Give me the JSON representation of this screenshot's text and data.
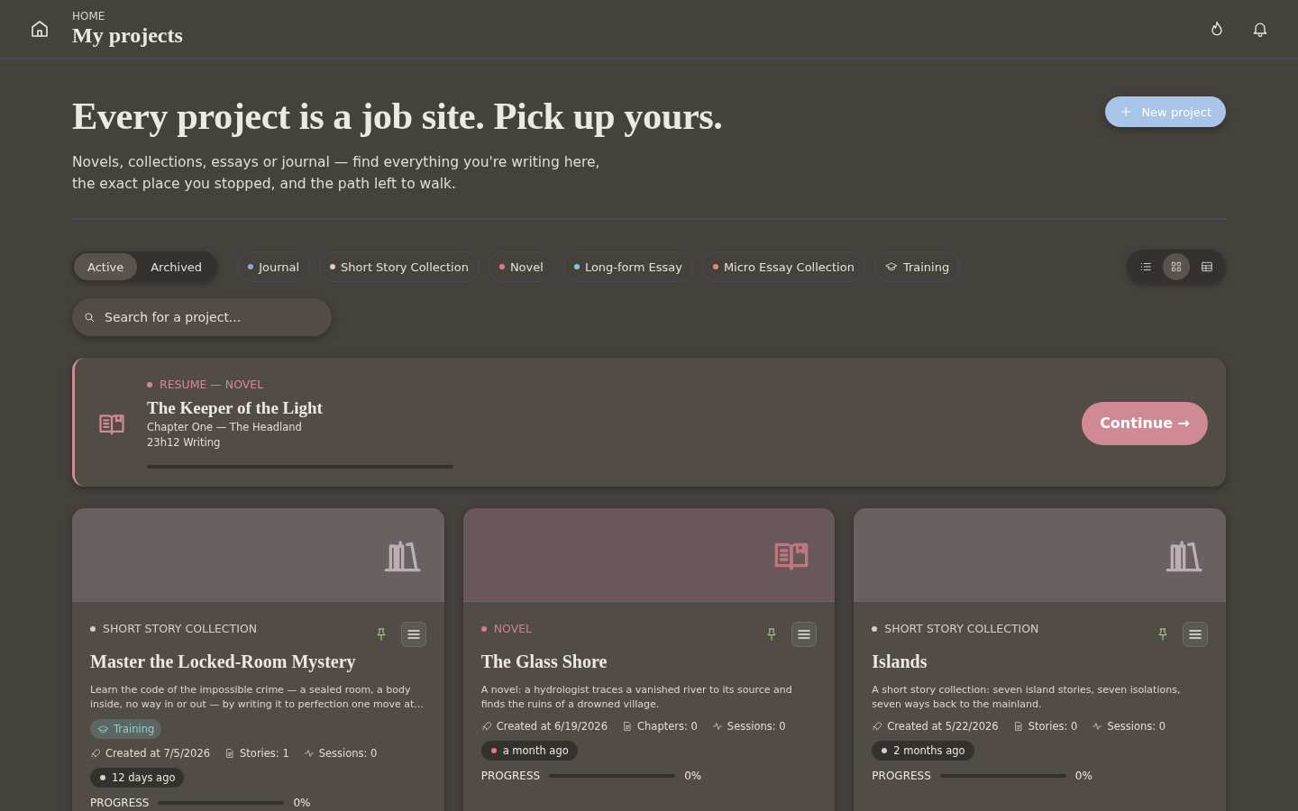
{
  "header": {
    "breadcrumb": "HOME",
    "title": "My projects"
  },
  "hero": {
    "title": "Every project is a job site. Pick up yours.",
    "subtitle": "Novels, collections, essays or journal — find everything you're writing here, the exact place you stopped, and the path left to walk.",
    "new_project": "New project"
  },
  "status_toggle": [
    {
      "label": "Active",
      "selected": true
    },
    {
      "label": "Archived",
      "selected": false
    }
  ],
  "type_filters": [
    {
      "label": "Journal",
      "kind": "dot",
      "color": "#8fa8d0"
    },
    {
      "label": "Short Story Collection",
      "kind": "dot",
      "color": "#e0c8cc"
    },
    {
      "label": "Novel",
      "kind": "dot",
      "color": "#d97b8a"
    },
    {
      "label": "Long-form Essay",
      "kind": "dot",
      "color": "#7fc6d8"
    },
    {
      "label": "Micro Essay Collection",
      "kind": "dot",
      "color": "#e08c70"
    },
    {
      "label": "Training",
      "kind": "training"
    }
  ],
  "view_modes": [
    {
      "kind": "list",
      "selected": false
    },
    {
      "kind": "grid",
      "selected": true
    },
    {
      "kind": "table",
      "selected": false
    }
  ],
  "search": {
    "placeholder": "Search for a project..."
  },
  "resume": {
    "eyebrow": "RESUME — NOVEL",
    "title": "The Keeper of the Light",
    "chapter": "Chapter One — The Headland",
    "time": "23h12 Writing",
    "level": 0,
    "button": "Continue →"
  },
  "projects": [
    {
      "type": "SHORT STORY COLLECTION",
      "kind": "collection",
      "color": "#d8ccd0",
      "title": "Master the Locked-Room Mystery",
      "description": "Learn the code of the impossible crime — a sealed room, a body inside, no way in or out — by writing it to perfection one move at...",
      "tag": "Training",
      "created": "Created at 7/5/2026",
      "count": "Stories: 1",
      "sessions": "Sessions: 0",
      "updated": "12 days ago",
      "progress_label": "PROGRESS",
      "progress": "0%",
      "level": 0
    },
    {
      "type": "NOVEL",
      "kind": "novel",
      "color": "#d97b8a",
      "title": "The Glass Shore",
      "description": "A novel: a hydrologist traces a vanished river to its source and finds the ruins of a drowned village.",
      "created": "Created at 6/19/2026",
      "count": "Chapters: 0",
      "sessions": "Sessions: 0",
      "updated": "a month ago",
      "progress_label": "PROGRESS",
      "progress": "0%",
      "level": 0
    },
    {
      "type": "SHORT STORY COLLECTION",
      "kind": "collection",
      "color": "#d8ccd0",
      "title": "Islands",
      "description": "A short story collection: seven island stories, seven isolations, seven ways back to the mainland.",
      "created": "Created at 5/22/2026",
      "count": "Stories: 0",
      "sessions": "Sessions: 0",
      "updated": "2 months ago",
      "progress_label": "PROGRESS",
      "progress": "0%",
      "level": 0
    }
  ]
}
